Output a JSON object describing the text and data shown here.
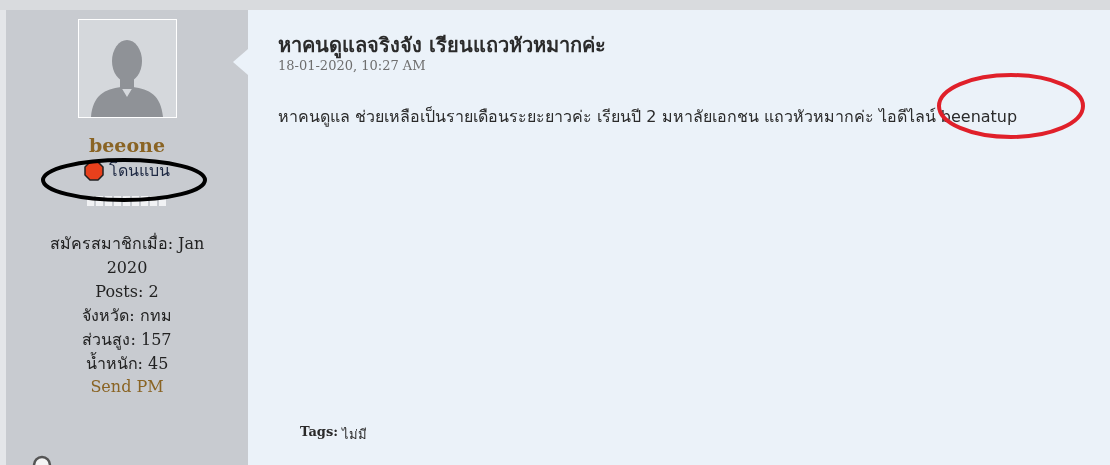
{
  "user": {
    "name": "beeone",
    "status": {
      "label": "โดนแบน",
      "kind": "banned"
    },
    "details": [
      "สมัครสมาชิกเมื่อ: Jan 2020",
      "Posts: 2",
      "จังหวัด: กทม",
      "ส่วนสูง: 157",
      "น้ำหนัก: 45"
    ],
    "send_pm": "Send PM"
  },
  "post": {
    "title": "หาคนดูแลจริงจัง เรียนแถวหัวหมากค่ะ",
    "date": "18-01-2020, 10:27 AM",
    "body": "หาคนดูแล ช่วยเหลือเป็นรายเดือนระยะยาวค่ะ เรียนปี 2 มหาลัยเอกชน แถวหัวหมากค่ะ ไอดีไลน์ beenatup",
    "tags_label": "Tags:",
    "tags_value": "ไม่มี"
  },
  "annotations": [
    {
      "kind": "ellipse",
      "color": "#000000"
    },
    {
      "kind": "ellipse",
      "color": "#e0202a"
    }
  ]
}
